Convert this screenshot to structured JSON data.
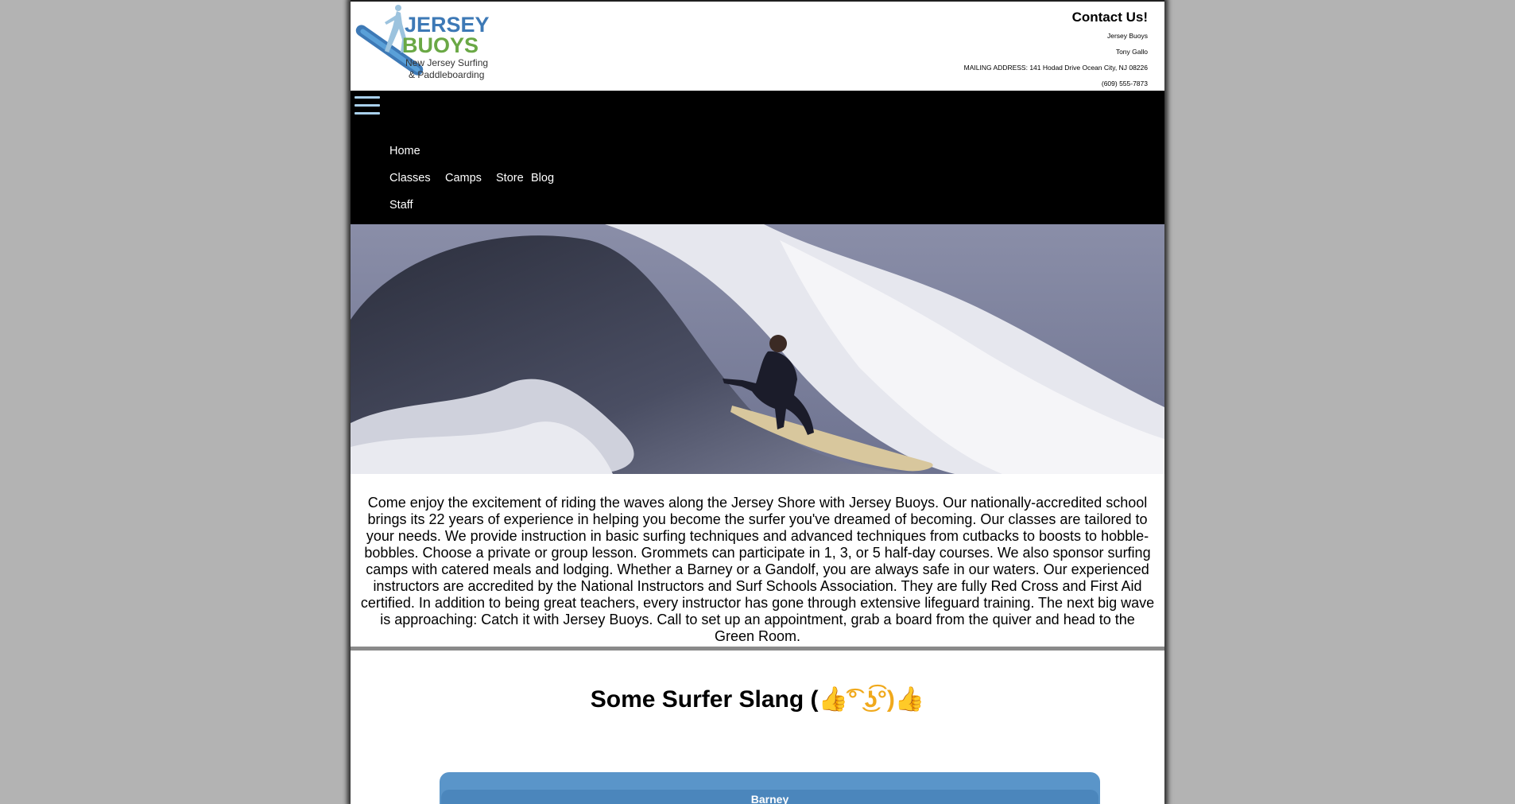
{
  "logo": {
    "line1": "JERSEY",
    "line2": "BUOYS",
    "line3": "New Jersey Surfing",
    "line4": "& Paddleboarding"
  },
  "contact": {
    "title": "Contact Us!",
    "business": "Jersey Buoys",
    "owner": "Tony Gallo",
    "address": "MAILING ADDRESS: 141 Hodad Drive Ocean City, NJ 08226",
    "phone": "(609) 555-7873"
  },
  "nav": {
    "menu_icon": "hamburger-menu-icon",
    "items": [
      {
        "label": "Home"
      },
      {
        "label": "Classes"
      },
      {
        "label": "Camps"
      },
      {
        "label": "Store"
      },
      {
        "label": "Blog"
      },
      {
        "label": "Staff"
      }
    ]
  },
  "hero": {
    "image": "surfer-riding-wave-photo"
  },
  "intro": {
    "text": "Come enjoy the excitement of riding the waves along the Jersey Shore with Jersey Buoys. Our nationally-accredited school brings its 22 years of experience in helping you become the surfer you've dreamed of becoming. Our classes are tailored to your needs. We provide instruction in basic surfing techniques and advanced techniques from cutbacks to boosts to hobble-bobbles. Choose a private or group lesson. Grommets can participate in 1, 3, or 5 half-day courses. We also sponsor surfing camps with catered meals and lodging. Whether a Barney or a Gandolf, you are always safe in our waters. Our experienced instructors are accredited by the National Instructors and Surf Schools Association. They are fully Red Cross and First Aid certified. In addition to being great teachers, every instructor has gone through extensive lifeguard training. The next big wave is approaching: Catch it with Jersey Buoys. Call to set up an appointment, grab a board from the quiver and head to the Green Room."
  },
  "slang": {
    "title": "Some Surfer Slang (",
    "title_emoji": "👍͡° ͜ʖ͡°)👍",
    "first_term": "Barney"
  },
  "colors": {
    "page_bg": "#b3b3b3",
    "nav_bg": "#000000",
    "menu_icon": "#a9d0ec",
    "accordion": "#5a95c9",
    "logo_blue": "#3d79b6",
    "logo_green": "#6aa845"
  }
}
